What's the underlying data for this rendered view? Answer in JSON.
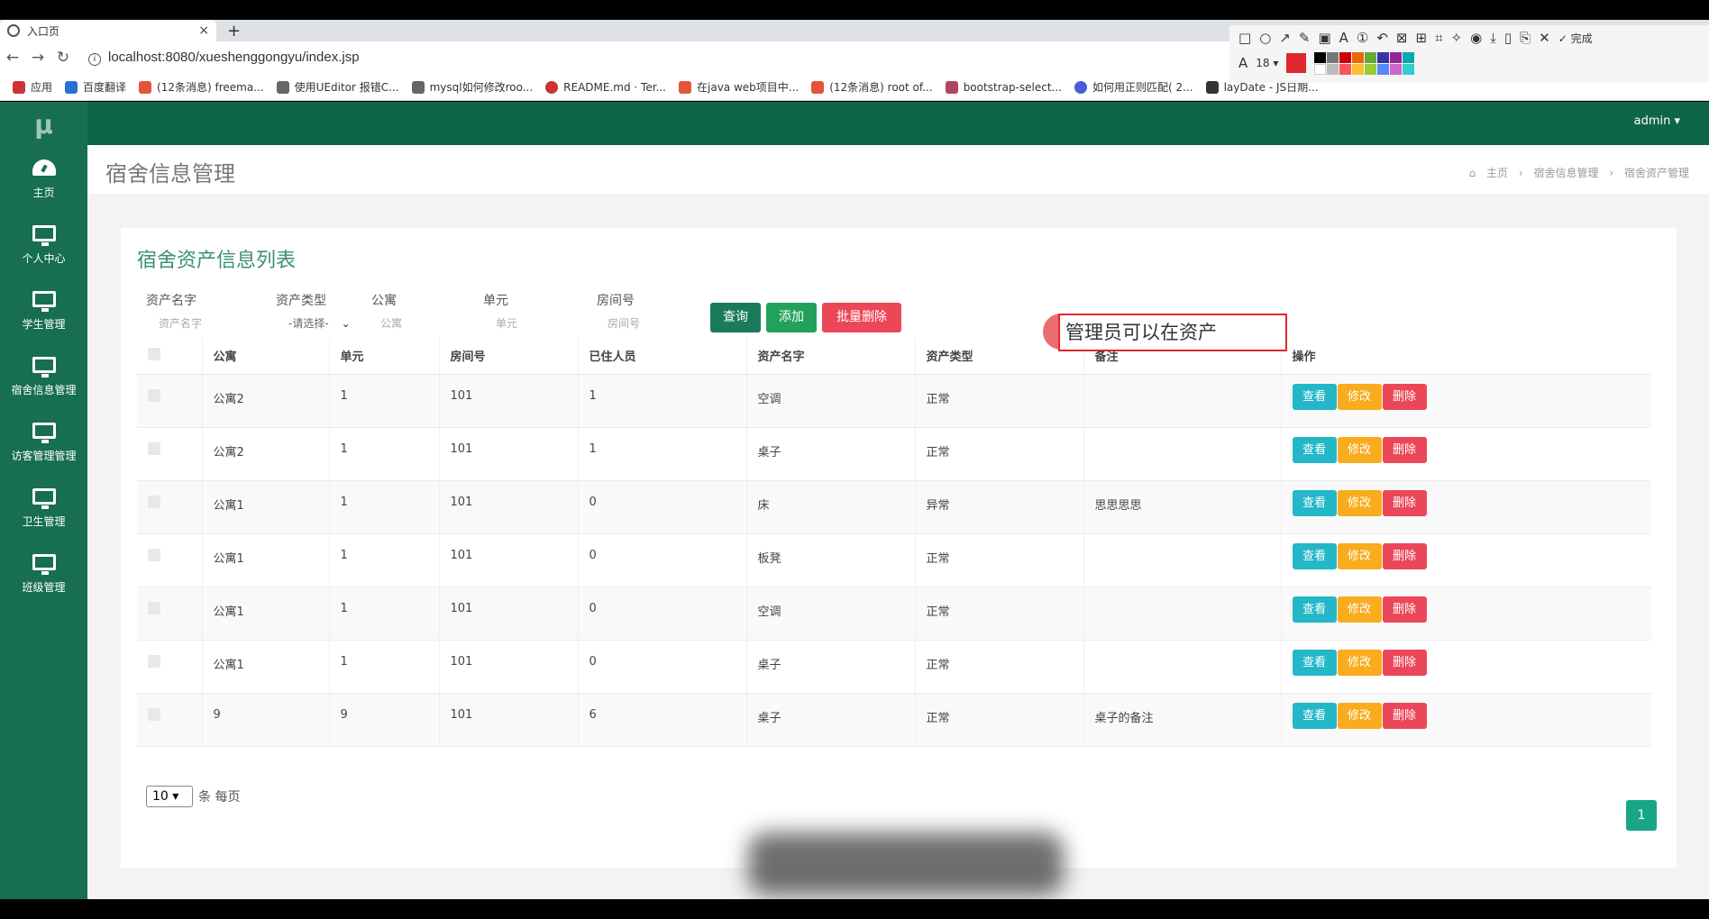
{
  "browser": {
    "tab_title": "入口页",
    "url": "localhost:8080/xueshenggongyu/index.jsp",
    "bookmarks": [
      "应用",
      "百度翻译",
      "(12条消息) freema...",
      "使用UEditor 报错C...",
      "mysql如何修改roo...",
      "README.md · Ter...",
      "在java web项目中...",
      "(12条消息) root of...",
      "bootstrap-select...",
      "如何用正则匹配( 2...",
      "layDate - JS日期..."
    ]
  },
  "annotation_toolbar": {
    "font_size": "18",
    "done_label": "完成",
    "active_color": "#e0262f"
  },
  "sidebar": {
    "logo": "μ",
    "items": [
      {
        "label": "主页",
        "icon": "dashboard-icon"
      },
      {
        "label": "个人中心",
        "icon": "monitor-icon"
      },
      {
        "label": "学生管理",
        "icon": "monitor-icon"
      },
      {
        "label": "宿舍信息管理",
        "icon": "monitor-icon"
      },
      {
        "label": "访客管理管理",
        "icon": "monitor-icon"
      },
      {
        "label": "卫生管理",
        "icon": "monitor-icon"
      },
      {
        "label": "班级管理",
        "icon": "monitor-icon"
      }
    ]
  },
  "topnav": {
    "user": "admin ▾"
  },
  "page": {
    "title": "宿舍信息管理",
    "breadcrumb": [
      "主页",
      "宿舍信息管理",
      "宿舍资产管理"
    ]
  },
  "card": {
    "title": "宿舍资产信息列表",
    "filters": {
      "asset_name_label": "资产名字",
      "asset_name_placeholder": "资产名字",
      "asset_type_label": "资产类型",
      "asset_type_value": "-请选择-",
      "apartment_label": "公寓",
      "apartment_placeholder": "公寓",
      "unit_label": "单元",
      "unit_placeholder": "单元",
      "room_label": "房间号",
      "room_placeholder": "房间号"
    },
    "buttons": {
      "query": "查询",
      "add": "添加",
      "batch_delete": "批量删除"
    },
    "annotation_text": "管理员可以在资产",
    "table": {
      "headers": [
        "公寓",
        "单元",
        "房间号",
        "已住人员",
        "资产名字",
        "资产类型",
        "备注",
        "操作"
      ],
      "rows": [
        [
          "公寓2",
          "1",
          "101",
          "1",
          "空调",
          "正常",
          ""
        ],
        [
          "公寓2",
          "1",
          "101",
          "1",
          "桌子",
          "正常",
          ""
        ],
        [
          "公寓1",
          "1",
          "101",
          "0",
          "床",
          "异常",
          "思思思思"
        ],
        [
          "公寓1",
          "1",
          "101",
          "0",
          "板凳",
          "正常",
          ""
        ],
        [
          "公寓1",
          "1",
          "101",
          "0",
          "空调",
          "正常",
          ""
        ],
        [
          "公寓1",
          "1",
          "101",
          "0",
          "桌子",
          "正常",
          ""
        ],
        [
          "9",
          "9",
          "101",
          "6",
          "桌子",
          "正常",
          "桌子的备注"
        ]
      ],
      "row_actions": {
        "view": "查看",
        "edit": "修改",
        "delete": "删除"
      }
    },
    "pager": {
      "page_size": "10",
      "per_page_label": "条 每页",
      "current_page": "1"
    }
  },
  "colors": {
    "sidebar": "#176e52",
    "topnav": "#0e6548",
    "query": "#1a7b5b",
    "add": "#22a15d",
    "batch_delete": "#ec4758",
    "view": "#23b7c8",
    "edit": "#f8ac1e",
    "delete": "#ec4758"
  }
}
